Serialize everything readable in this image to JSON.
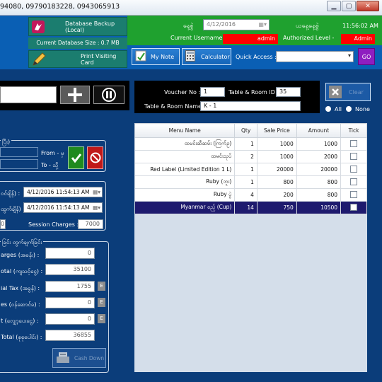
{
  "title": "94080, 09790183228, 0943065913",
  "header": {
    "db_backup_label": "Database Backup (Local)",
    "db_size_label": "Current Database Size : 0.7 MB",
    "print_card_label": "Print Visiting Card",
    "date_label": "နေ့စွဲ",
    "date_value": "4/12/2016",
    "today_label": "ယနေ့နေ့စွဲ",
    "clock": "11:56:02 AM",
    "username_label": "Current Username -",
    "username_value": "admin",
    "auth_level_label": "Authorized Level -",
    "auth_level_value": "Admin",
    "my_note_label": "My Note",
    "calculator_label": "Calculator",
    "quick_access_label": "Quick Access :",
    "quick_access_value": "",
    "go_label": "GO"
  },
  "voucher": {
    "voucher_no_label": "Voucher No :",
    "voucher_no_value": "1",
    "table_room_id_label": "Table & Room ID :",
    "table_room_id_value": "35",
    "table_room_name_label": "Table & Room Name :",
    "table_room_name_value": "K - 1",
    "clear_label": "Clear",
    "radio_all": "All",
    "radio_none": "None"
  },
  "left": {
    "filter_group_title": "ပြီး)",
    "from_label": "From - မှ",
    "to_label": "To - သို့",
    "start_label": "ဝင်ချိန်) :",
    "start_value": "4/12/2016 11:54:13 AM",
    "end_label": "ထွက်ချိန်) :",
    "end_value": "4/12/2016 11:54:13 AM",
    "left_value": "0",
    "session_label": "Session Charges :",
    "session_value": "7000",
    "summary_title": "ခြင်း တွက်ချက်ခြင်း",
    "rows": [
      {
        "label": "arges (အခန်း) :",
        "value": "0",
        "e": false
      },
      {
        "label": "otal (ကျသင့်ငွေ) :",
        "value": "35100",
        "e": false
      },
      {
        "label": "ial Tax (အခွန်) :",
        "value": "1755",
        "e": true
      },
      {
        "label": "es (ဝန်ဆောင်ခ) :",
        "value": "0",
        "e": true
      },
      {
        "label": "t (လျှော့ပေးငွေ) :",
        "value": "0",
        "e": true
      },
      {
        "label": "Total (စုစုပေါင်း) :",
        "value": "36855",
        "e": false
      }
    ],
    "e_label": "E",
    "cash_down_label": "Cash Down"
  },
  "table": {
    "columns": [
      "Menu Name",
      "Qty",
      "Sale Price",
      "Amount",
      "Tick"
    ],
    "rows": [
      {
        "name": "ထမင်းဆီဆမ်း (ကြက်ဥ)",
        "qty": "1",
        "price": "1000",
        "amount": "1000"
      },
      {
        "name": "ထမင်းသုပ်",
        "qty": "2",
        "price": "1000",
        "amount": "2000"
      },
      {
        "name": "Red Label (Limited Edition 1 L)",
        "qty": "1",
        "price": "20000",
        "amount": "20000"
      },
      {
        "name": "Ruby (ဘူး)",
        "qty": "1",
        "price": "800",
        "amount": "800"
      },
      {
        "name": "Ruby ပွဲ",
        "qty": "4",
        "price": "200",
        "amount": "800"
      },
      {
        "name": "Myanmar ဧည့် (Cup)",
        "qty": "14",
        "price": "750",
        "amount": "10500"
      }
    ],
    "selected_row": 5
  }
}
